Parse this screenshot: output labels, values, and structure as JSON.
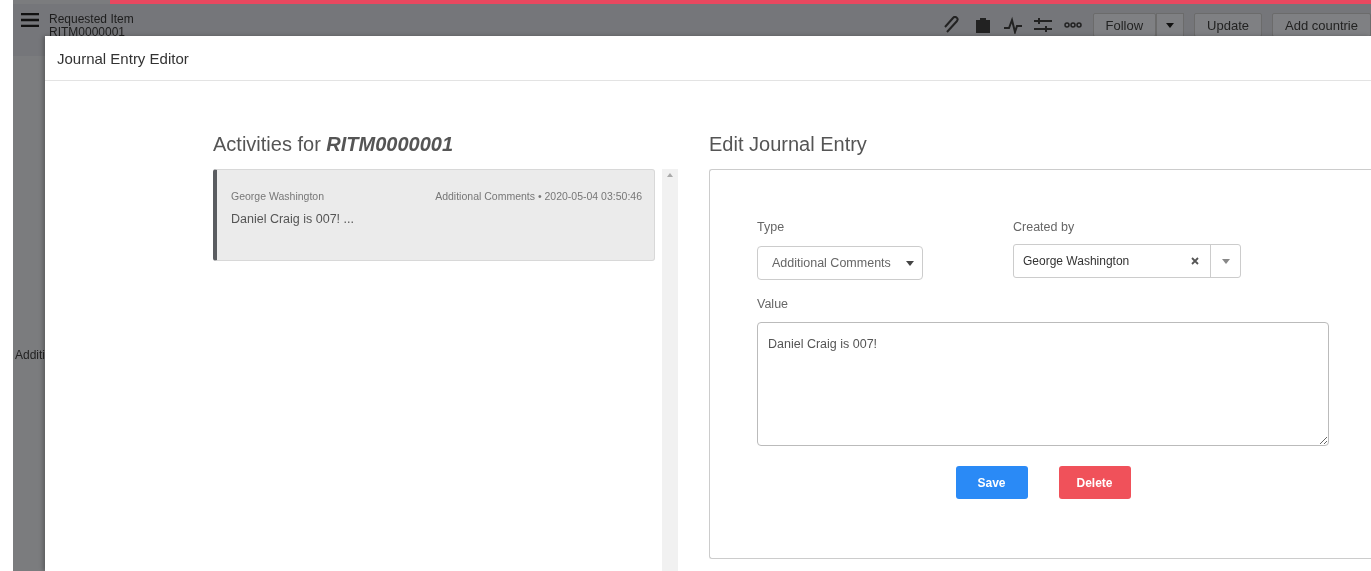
{
  "record_header": {
    "title": "Requested Item",
    "subtitle": "RITM0000001",
    "buttons": [
      {
        "label": "Follow",
        "kind": "split"
      },
      {
        "label": "Update",
        "kind": "plain"
      },
      {
        "label": "Add countrie",
        "kind": "plain"
      }
    ]
  },
  "background_field": {
    "label": "Additi"
  },
  "modal": {
    "title": "Journal Entry Editor",
    "activities": {
      "heading": "Activities for **RITM0000001**",
      "items": [
        {
          "author": "George Washington",
          "meta": "Additional Comments • 2020-05-04 03:50:46",
          "text": "Daniel Craig is 007! ...",
          "selected": true
        }
      ]
    },
    "editor": {
      "heading": "Edit Journal Entry",
      "type_label": "Type",
      "type_value": "Additional Comments",
      "created_by_label": "Created by",
      "created_by_value": "George Washington",
      "value_label": "Value",
      "value": "Daniel Craig is 007!",
      "buttons": [
        {
          "label": "Save",
          "kind": "primary"
        },
        {
          "label": "Delete",
          "kind": "danger"
        }
      ]
    }
  }
}
